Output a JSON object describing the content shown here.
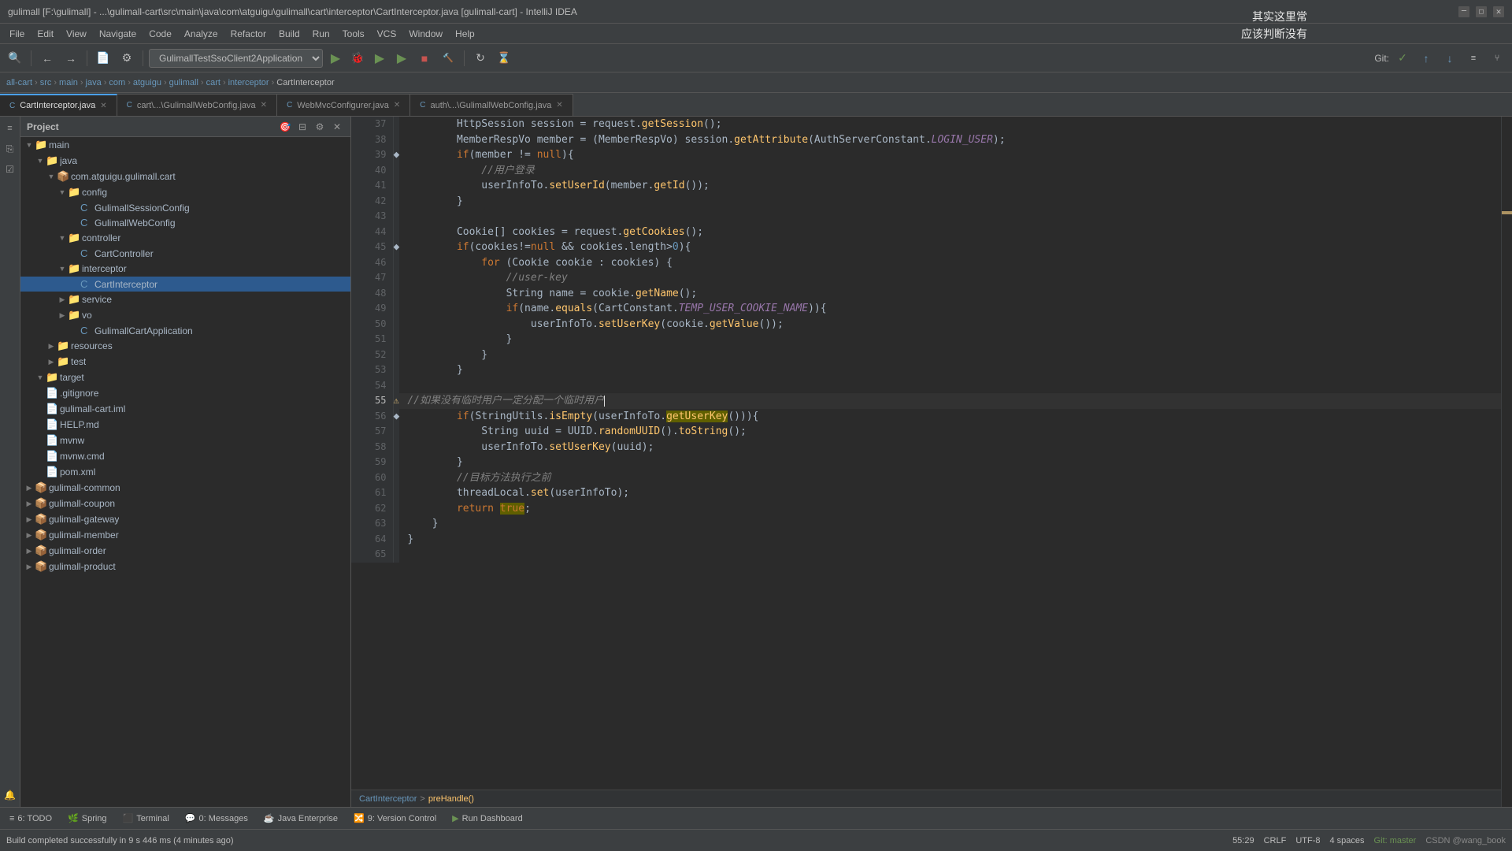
{
  "title": {
    "text": "gulimall [F:\\gulimall] - ...\\gulimall-cart\\src\\main\\java\\com\\atguigu\\gulimall\\cart\\interceptor\\CartInterceptor.java [gulimall-cart] - IntelliJ IDEA",
    "window_controls": [
      "minimize",
      "maximize",
      "close"
    ]
  },
  "menu": {
    "items": [
      "File",
      "Edit",
      "View",
      "Navigate",
      "Code",
      "Analyze",
      "Refactor",
      "Build",
      "Run",
      "Tools",
      "VCS",
      "Window",
      "Help"
    ]
  },
  "breadcrumb": {
    "items": [
      "all-cart",
      "src",
      "main",
      "java",
      "com",
      "atguigu",
      "gulimall",
      "cart",
      "interceptor",
      "CartInterceptor"
    ]
  },
  "tabs": [
    {
      "label": "CartInterceptor.java",
      "active": true,
      "icon": "C"
    },
    {
      "label": "cart\\...\\GulimallWebConfig.java",
      "active": false,
      "icon": "C"
    },
    {
      "label": "WebMvcConfigurer.java",
      "active": false,
      "icon": "C"
    },
    {
      "label": "auth\\...\\GulimallWebConfig.java",
      "active": false,
      "icon": "C"
    }
  ],
  "project_tree": {
    "title": "Project",
    "items": [
      {
        "indent": 0,
        "expanded": true,
        "label": "main",
        "type": "folder"
      },
      {
        "indent": 1,
        "expanded": true,
        "label": "java",
        "type": "folder"
      },
      {
        "indent": 2,
        "expanded": true,
        "label": "com.atguigu.gulimall.cart",
        "type": "package"
      },
      {
        "indent": 3,
        "expanded": true,
        "label": "config",
        "type": "folder"
      },
      {
        "indent": 4,
        "expanded": false,
        "label": "GulimallSessionConfig",
        "type": "class",
        "icon": "C"
      },
      {
        "indent": 4,
        "expanded": false,
        "label": "GulimallWebConfig",
        "type": "class",
        "icon": "C"
      },
      {
        "indent": 3,
        "expanded": true,
        "label": "controller",
        "type": "folder"
      },
      {
        "indent": 4,
        "expanded": false,
        "label": "CartController",
        "type": "class",
        "icon": "C"
      },
      {
        "indent": 3,
        "expanded": true,
        "label": "interceptor",
        "type": "folder"
      },
      {
        "indent": 4,
        "expanded": false,
        "label": "CartInterceptor",
        "type": "class",
        "icon": "C",
        "selected": true
      },
      {
        "indent": 3,
        "expanded": false,
        "label": "service",
        "type": "folder"
      },
      {
        "indent": 3,
        "expanded": false,
        "label": "vo",
        "type": "folder"
      },
      {
        "indent": 4,
        "expanded": false,
        "label": "GulimallCartApplication",
        "type": "class",
        "icon": "C"
      },
      {
        "indent": 2,
        "expanded": false,
        "label": "resources",
        "type": "folder"
      },
      {
        "indent": 2,
        "expanded": false,
        "label": "test",
        "type": "folder"
      },
      {
        "indent": 1,
        "expanded": true,
        "label": "target",
        "type": "folder"
      },
      {
        "indent": 2,
        "expanded": false,
        "label": ".gitignore",
        "type": "file"
      },
      {
        "indent": 2,
        "expanded": false,
        "label": "gulimall-cart.iml",
        "type": "file"
      },
      {
        "indent": 2,
        "expanded": false,
        "label": "HELP.md",
        "type": "file"
      },
      {
        "indent": 2,
        "expanded": false,
        "label": "mvnw",
        "type": "file"
      },
      {
        "indent": 2,
        "expanded": false,
        "label": "mvnw.cmd",
        "type": "file"
      },
      {
        "indent": 2,
        "expanded": false,
        "label": "pom.xml",
        "type": "file"
      },
      {
        "indent": 0,
        "expanded": false,
        "label": "gulimall-common",
        "type": "module"
      },
      {
        "indent": 0,
        "expanded": false,
        "label": "gulimall-coupon",
        "type": "module"
      },
      {
        "indent": 0,
        "expanded": false,
        "label": "gulimall-gateway",
        "type": "module"
      },
      {
        "indent": 0,
        "expanded": false,
        "label": "gulimall-member",
        "type": "module"
      },
      {
        "indent": 0,
        "expanded": false,
        "label": "gulimall-order",
        "type": "module"
      },
      {
        "indent": 0,
        "expanded": false,
        "label": "gulimall-product",
        "type": "module"
      }
    ]
  },
  "code": {
    "lines": [
      {
        "num": 37,
        "content": "        HttpSession session = request.getSession();",
        "type": "code"
      },
      {
        "num": 38,
        "content": "        MemberRespVo member = (MemberRespVo) session.getAttribute(AuthServerConstant.LOGIN_USER);",
        "type": "code"
      },
      {
        "num": 39,
        "content": "        if(member != null){",
        "type": "code"
      },
      {
        "num": 40,
        "content": "            //用户登录",
        "type": "comment"
      },
      {
        "num": 41,
        "content": "            userInfoTo.setUserId(member.getId());",
        "type": "code"
      },
      {
        "num": 42,
        "content": "        }",
        "type": "code"
      },
      {
        "num": 43,
        "content": "",
        "type": "empty"
      },
      {
        "num": 44,
        "content": "        Cookie[] cookies = request.getCookies();",
        "type": "code"
      },
      {
        "num": 45,
        "content": "        if(cookies!=null && cookies.length>0){",
        "type": "code"
      },
      {
        "num": 46,
        "content": "            for (Cookie cookie : cookies) {",
        "type": "code"
      },
      {
        "num": 47,
        "content": "                //user-key",
        "type": "comment"
      },
      {
        "num": 48,
        "content": "                String name = cookie.getName();",
        "type": "code"
      },
      {
        "num": 49,
        "content": "                if(name.equals(CartConstant.TEMP_USER_COOKIE_NAME)){",
        "type": "code"
      },
      {
        "num": 50,
        "content": "                    userInfoTo.setUserKey(cookie.getValue());",
        "type": "code"
      },
      {
        "num": 51,
        "content": "                }",
        "type": "code"
      },
      {
        "num": 52,
        "content": "            }",
        "type": "code"
      },
      {
        "num": 53,
        "content": "        }",
        "type": "code"
      },
      {
        "num": 54,
        "content": "",
        "type": "empty"
      },
      {
        "num": 55,
        "content": "        //如果没有临时用户一定分配一个临时用户",
        "type": "comment",
        "cursor": true,
        "warning": true
      },
      {
        "num": 56,
        "content": "        if(StringUtils.isEmpty(userInfoTo.getUserKey())){",
        "type": "code"
      },
      {
        "num": 57,
        "content": "            String uuid = UUID.randomUUID().toString();",
        "type": "code"
      },
      {
        "num": 58,
        "content": "            userInfoTo.setUserKey(uuid);",
        "type": "code"
      },
      {
        "num": 59,
        "content": "        }",
        "type": "code"
      },
      {
        "num": 60,
        "content": "        //目标方法执行之前",
        "type": "comment"
      },
      {
        "num": 61,
        "content": "        threadLocal.set(userInfoTo);",
        "type": "code"
      },
      {
        "num": 62,
        "content": "        return true;",
        "type": "code",
        "highlight": true
      },
      {
        "num": 63,
        "content": "    }",
        "type": "code"
      },
      {
        "num": 64,
        "content": "}",
        "type": "code"
      },
      {
        "num": 65,
        "content": "",
        "type": "empty"
      }
    ],
    "breadcrumb": "CartInterceptor > preHandle()"
  },
  "run_config": {
    "label": "GulimallTestSsoClient2Application",
    "buttons": [
      "run",
      "debug",
      "coverage",
      "profile",
      "stop",
      "restart"
    ]
  },
  "git": {
    "label": "Git:"
  },
  "status_bar": {
    "left": "Build completed successfully in 9 s 446 ms (4 minutes ago)",
    "position": "55:29",
    "encoding": "CRLF",
    "charset": "UTF-8",
    "indent": "4 spaces",
    "vcs": "Git: master",
    "user": "CSDN @wang_book"
  },
  "bottom_tabs": [
    {
      "label": "TODO",
      "icon": "≡"
    },
    {
      "label": "Spring",
      "icon": "🌿"
    },
    {
      "label": "Terminal",
      "icon": ">"
    },
    {
      "label": "Messages",
      "icon": "0:"
    },
    {
      "label": "Java Enterprise",
      "icon": "☕"
    },
    {
      "label": "Version Control",
      "icon": "9:"
    },
    {
      "label": "Run Dashboard",
      "icon": "▶"
    }
  ],
  "watermark": {
    "lines": [
      "其实这里常",
      "应该判断没有"
    ]
  },
  "colors": {
    "keyword": "#cc7832",
    "string": "#6a8759",
    "comment": "#808080",
    "number": "#6897bb",
    "method": "#ffc66d",
    "const_italic": "#9876aa",
    "accent_blue": "#4a9fe8",
    "background": "#2b2b2b",
    "sidebar_bg": "#2b2b2b",
    "toolbar_bg": "#3c3f41",
    "selected_tab_border": "#4a9fe8",
    "line_number_bg": "#313335"
  }
}
